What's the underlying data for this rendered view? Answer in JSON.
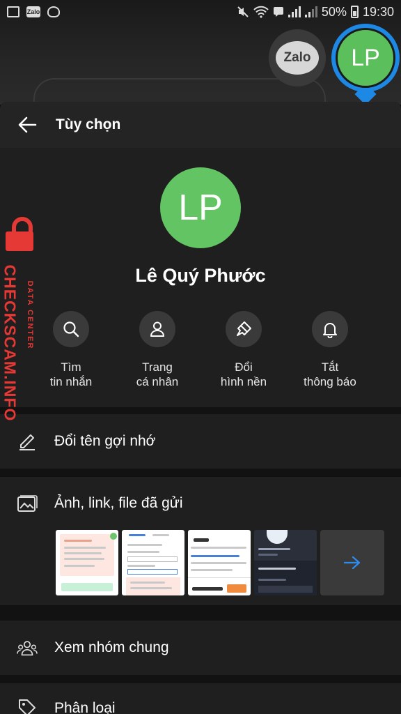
{
  "status_bar": {
    "battery": "50%",
    "time": "19:30",
    "zalo_icon_label": "Zalo"
  },
  "chat_heads": {
    "zalo_label": "Zalo",
    "contact_initials": "LP"
  },
  "header": {
    "title": "Tùy chọn"
  },
  "profile": {
    "initials": "LP",
    "name": "Lê Quý Phước",
    "avatar_color": "#62c462"
  },
  "actions": [
    {
      "label": "Tìm\ntin nhắn",
      "icon": "search-icon"
    },
    {
      "label": "Trang\ncá nhân",
      "icon": "person-icon"
    },
    {
      "label": "Đổi\nhình nền",
      "icon": "paint-brush-icon"
    },
    {
      "label": "Tắt\nthông báo",
      "icon": "bell-icon"
    }
  ],
  "menu": {
    "rename": "Đổi tên gợi nhớ",
    "media": "Ảnh, link, file đã gửi",
    "groups": "Xem nhóm chung",
    "classify": "Phân loại"
  },
  "watermark": {
    "main": "CHECKSCAM.INFO",
    "sub": "DATA CENTER"
  },
  "colors": {
    "accent_blue": "#1e88e5",
    "watermark_red": "#e53935",
    "panel_bg": "#1f1f1f"
  }
}
